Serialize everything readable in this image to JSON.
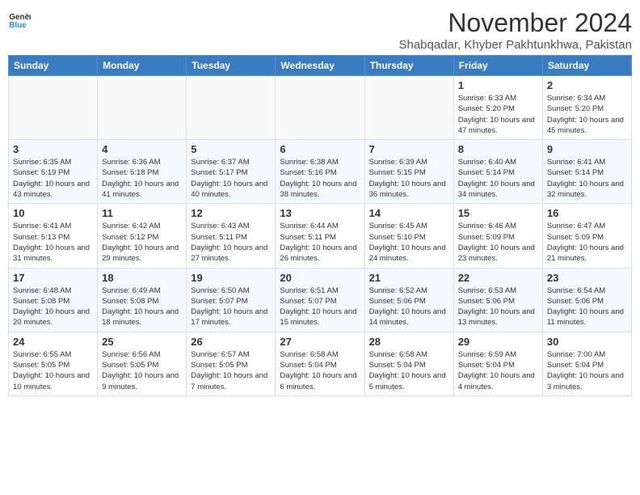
{
  "header": {
    "logo": {
      "general": "General",
      "blue": "Blue"
    },
    "title": "November 2024",
    "location": "Shabqadar, Khyber Pakhtunkhwa, Pakistan"
  },
  "calendar": {
    "days_of_week": [
      "Sunday",
      "Monday",
      "Tuesday",
      "Wednesday",
      "Thursday",
      "Friday",
      "Saturday"
    ],
    "weeks": [
      [
        {
          "day": "",
          "info": ""
        },
        {
          "day": "",
          "info": ""
        },
        {
          "day": "",
          "info": ""
        },
        {
          "day": "",
          "info": ""
        },
        {
          "day": "",
          "info": ""
        },
        {
          "day": "1",
          "info": "Sunrise: 6:33 AM\nSunset: 5:20 PM\nDaylight: 10 hours and 47 minutes."
        },
        {
          "day": "2",
          "info": "Sunrise: 6:34 AM\nSunset: 5:20 PM\nDaylight: 10 hours and 45 minutes."
        }
      ],
      [
        {
          "day": "3",
          "info": "Sunrise: 6:35 AM\nSunset: 5:19 PM\nDaylight: 10 hours and 43 minutes."
        },
        {
          "day": "4",
          "info": "Sunrise: 6:36 AM\nSunset: 5:18 PM\nDaylight: 10 hours and 41 minutes."
        },
        {
          "day": "5",
          "info": "Sunrise: 6:37 AM\nSunset: 5:17 PM\nDaylight: 10 hours and 40 minutes."
        },
        {
          "day": "6",
          "info": "Sunrise: 6:38 AM\nSunset: 5:16 PM\nDaylight: 10 hours and 38 minutes."
        },
        {
          "day": "7",
          "info": "Sunrise: 6:39 AM\nSunset: 5:15 PM\nDaylight: 10 hours and 36 minutes."
        },
        {
          "day": "8",
          "info": "Sunrise: 6:40 AM\nSunset: 5:14 PM\nDaylight: 10 hours and 34 minutes."
        },
        {
          "day": "9",
          "info": "Sunrise: 6:41 AM\nSunset: 5:14 PM\nDaylight: 10 hours and 32 minutes."
        }
      ],
      [
        {
          "day": "10",
          "info": "Sunrise: 6:41 AM\nSunset: 5:13 PM\nDaylight: 10 hours and 31 minutes."
        },
        {
          "day": "11",
          "info": "Sunrise: 6:42 AM\nSunset: 5:12 PM\nDaylight: 10 hours and 29 minutes."
        },
        {
          "day": "12",
          "info": "Sunrise: 6:43 AM\nSunset: 5:11 PM\nDaylight: 10 hours and 27 minutes."
        },
        {
          "day": "13",
          "info": "Sunrise: 6:44 AM\nSunset: 5:11 PM\nDaylight: 10 hours and 26 minutes."
        },
        {
          "day": "14",
          "info": "Sunrise: 6:45 AM\nSunset: 5:10 PM\nDaylight: 10 hours and 24 minutes."
        },
        {
          "day": "15",
          "info": "Sunrise: 6:46 AM\nSunset: 5:09 PM\nDaylight: 10 hours and 23 minutes."
        },
        {
          "day": "16",
          "info": "Sunrise: 6:47 AM\nSunset: 5:09 PM\nDaylight: 10 hours and 21 minutes."
        }
      ],
      [
        {
          "day": "17",
          "info": "Sunrise: 6:48 AM\nSunset: 5:08 PM\nDaylight: 10 hours and 20 minutes."
        },
        {
          "day": "18",
          "info": "Sunrise: 6:49 AM\nSunset: 5:08 PM\nDaylight: 10 hours and 18 minutes."
        },
        {
          "day": "19",
          "info": "Sunrise: 6:50 AM\nSunset: 5:07 PM\nDaylight: 10 hours and 17 minutes."
        },
        {
          "day": "20",
          "info": "Sunrise: 6:51 AM\nSunset: 5:07 PM\nDaylight: 10 hours and 15 minutes."
        },
        {
          "day": "21",
          "info": "Sunrise: 6:52 AM\nSunset: 5:06 PM\nDaylight: 10 hours and 14 minutes."
        },
        {
          "day": "22",
          "info": "Sunrise: 6:53 AM\nSunset: 5:06 PM\nDaylight: 10 hours and 13 minutes."
        },
        {
          "day": "23",
          "info": "Sunrise: 6:54 AM\nSunset: 5:06 PM\nDaylight: 10 hours and 11 minutes."
        }
      ],
      [
        {
          "day": "24",
          "info": "Sunrise: 6:55 AM\nSunset: 5:05 PM\nDaylight: 10 hours and 10 minutes."
        },
        {
          "day": "25",
          "info": "Sunrise: 6:56 AM\nSunset: 5:05 PM\nDaylight: 10 hours and 9 minutes."
        },
        {
          "day": "26",
          "info": "Sunrise: 6:57 AM\nSunset: 5:05 PM\nDaylight: 10 hours and 7 minutes."
        },
        {
          "day": "27",
          "info": "Sunrise: 6:58 AM\nSunset: 5:04 PM\nDaylight: 10 hours and 6 minutes."
        },
        {
          "day": "28",
          "info": "Sunrise: 6:58 AM\nSunset: 5:04 PM\nDaylight: 10 hours and 5 minutes."
        },
        {
          "day": "29",
          "info": "Sunrise: 6:59 AM\nSunset: 5:04 PM\nDaylight: 10 hours and 4 minutes."
        },
        {
          "day": "30",
          "info": "Sunrise: 7:00 AM\nSunset: 5:04 PM\nDaylight: 10 hours and 3 minutes."
        }
      ]
    ]
  }
}
